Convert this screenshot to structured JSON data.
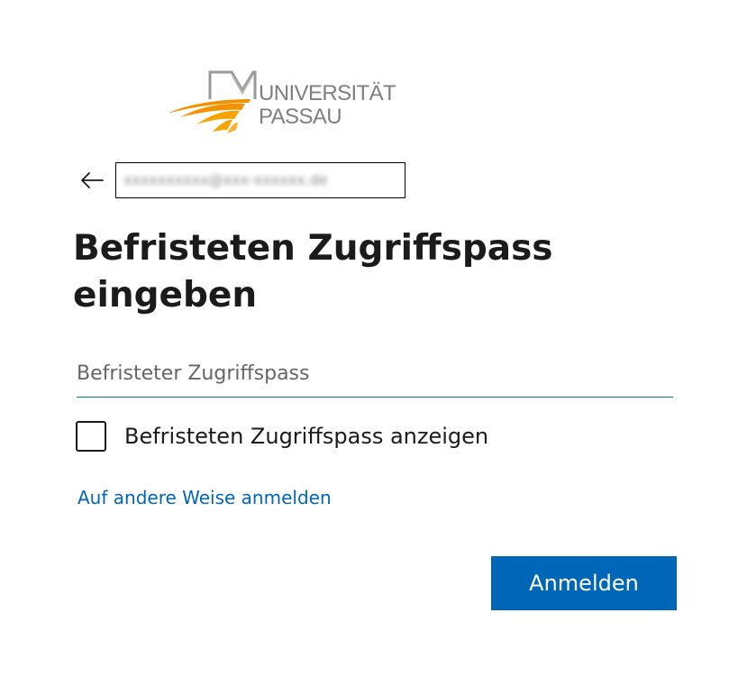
{
  "logo": {
    "line1": "UNIVERSITÄT",
    "line2": "PASSAU",
    "icon": "university-book-logo",
    "colors": {
      "orange": "#f29200",
      "gray": "#7f7f7f"
    }
  },
  "back": {
    "icon": "arrow-left-icon"
  },
  "identity": {
    "text": "xxxxxxxxxx@xxx-xxxxxx.de"
  },
  "title": {
    "line1": "Befristeten Zugriffspass",
    "line2": "eingeben"
  },
  "input": {
    "placeholder": "Befristeter Zugriffspass",
    "value": ""
  },
  "show_pass": {
    "label": "Befristeten Zugriffspass anzeigen",
    "checked": false
  },
  "link": {
    "text": "Auf andere Weise anmelden"
  },
  "button": {
    "label": "Anmelden"
  },
  "colors": {
    "accent": "#0067b8",
    "input_border": "#0a7a83",
    "text": "#1b1b1b"
  }
}
